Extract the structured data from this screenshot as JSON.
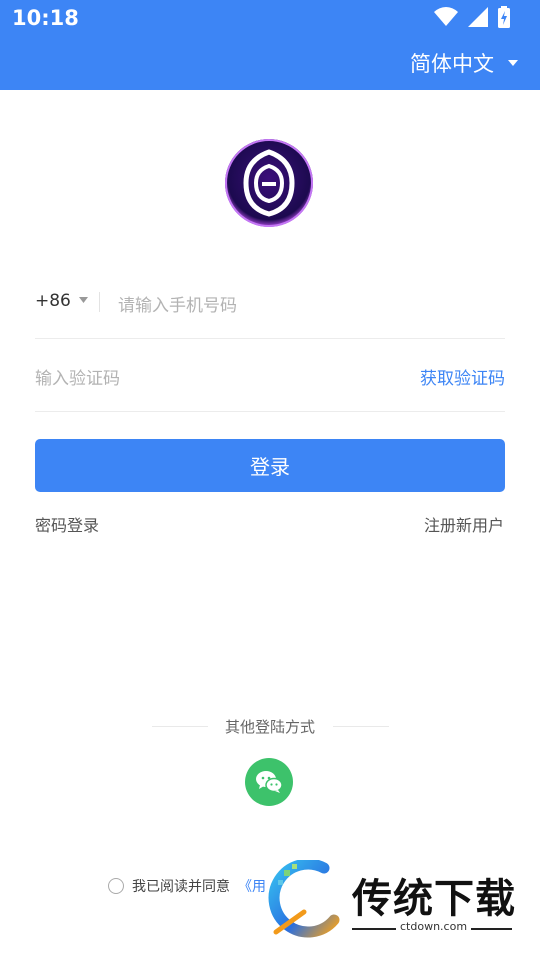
{
  "status_bar": {
    "time": "10:18",
    "icons": [
      "wifi-icon",
      "signal-icon",
      "battery-charging-icon"
    ]
  },
  "header": {
    "language": "简体中文",
    "language_icon": "caret-down-icon"
  },
  "form": {
    "country_code": "+86",
    "phone_placeholder": "请输入手机号码",
    "code_placeholder": "输入验证码",
    "get_code_label": "获取验证码",
    "login_label": "登录"
  },
  "links": {
    "password_login": "密码登录",
    "register": "注册新用户"
  },
  "other_login": {
    "title": "其他登陆方式",
    "icon": "wechat-icon"
  },
  "agreement": {
    "prefix": "我已阅读并同意",
    "link": "《用"
  },
  "watermark": {
    "title": "传统下载",
    "url": "ctdown.com"
  },
  "colors": {
    "primary": "#3d85f5",
    "wechat": "#3dc26b",
    "logo_bg": "#2a0a5e"
  }
}
